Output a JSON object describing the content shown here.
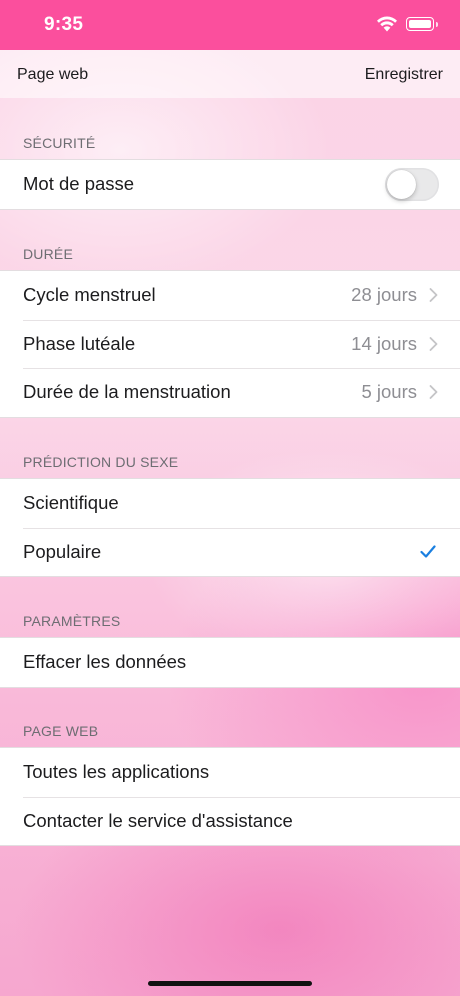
{
  "status_bar": {
    "time": "9:35"
  },
  "nav": {
    "left_label": "Page web",
    "right_label": "Enregistrer"
  },
  "sections": {
    "security": {
      "header": "SÉCURITÉ",
      "password_label": "Mot de passe",
      "password_enabled": false
    },
    "duration": {
      "header": "DURÉE",
      "rows": [
        {
          "label": "Cycle menstruel",
          "value": "28 jours"
        },
        {
          "label": "Phase lutéale",
          "value": "14 jours"
        },
        {
          "label": "Durée de la menstruation",
          "value": "5 jours"
        }
      ]
    },
    "sex_prediction": {
      "header": "PRÉDICTION DU SEXE",
      "rows": [
        {
          "label": "Scientifique",
          "selected": false
        },
        {
          "label": "Populaire",
          "selected": true
        }
      ]
    },
    "settings": {
      "header": "PARAMÈTRES",
      "rows": [
        {
          "label": "Effacer les données"
        }
      ]
    },
    "web_page": {
      "header": "PAGE WEB",
      "rows": [
        {
          "label": "Toutes les applications"
        },
        {
          "label": "Contacter le service d'assistance"
        }
      ]
    }
  },
  "colors": {
    "status_bar": "#fb4f9d",
    "checkmark": "#1a7fe0",
    "secondary_text": "#8e8e93"
  }
}
